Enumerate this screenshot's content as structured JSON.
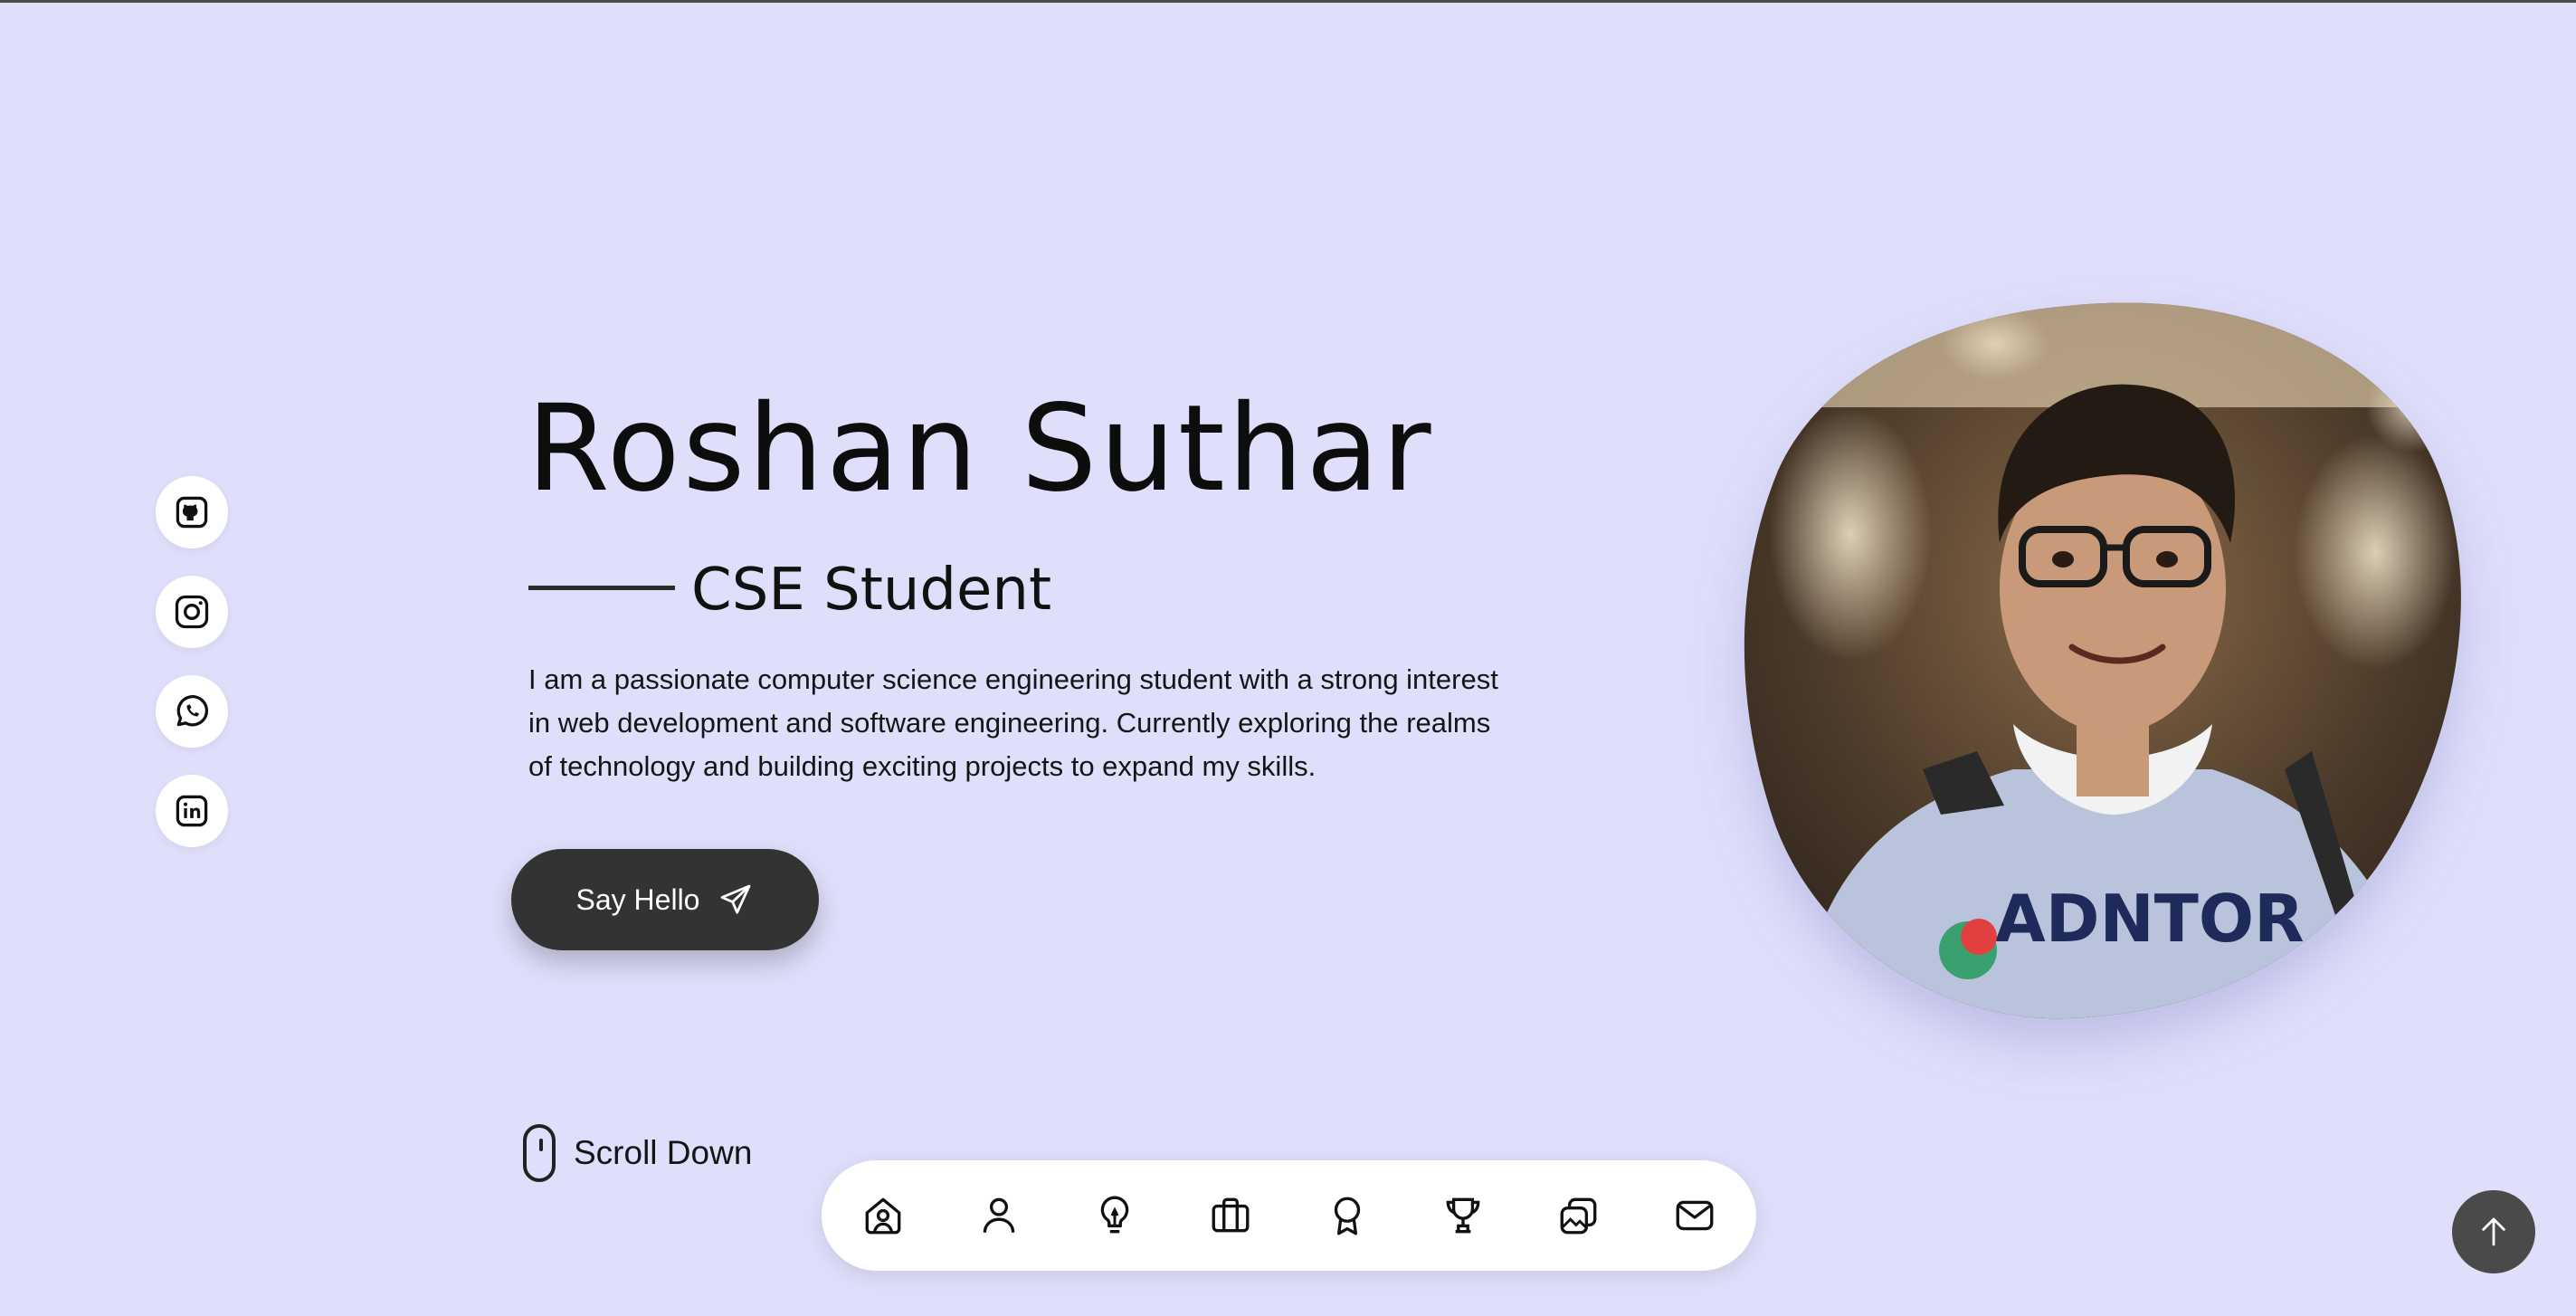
{
  "profile": {
    "name": "Roshan Suthar",
    "title": "CSE Student",
    "bio": "I am a passionate computer science engineering student with a strong interest in web development and software engineering. Currently exploring the realms of technology and building exciting projects to expand my skills.",
    "photo_shirt_text": "ADNTOR"
  },
  "buttons": {
    "say_hello": "Say Hello",
    "scroll_down": "Scroll Down"
  },
  "social": [
    {
      "icon": "github-icon"
    },
    {
      "icon": "instagram-icon"
    },
    {
      "icon": "whatsapp-icon"
    },
    {
      "icon": "linkedin-icon"
    }
  ],
  "nav": [
    {
      "icon": "home-icon"
    },
    {
      "icon": "user-icon"
    },
    {
      "icon": "lightbulb-icon"
    },
    {
      "icon": "briefcase-icon"
    },
    {
      "icon": "award-icon"
    },
    {
      "icon": "trophy-icon"
    },
    {
      "icon": "gallery-icon"
    },
    {
      "icon": "mail-icon"
    }
  ],
  "colors": {
    "background": "#dfdffb",
    "button_dark": "#333333",
    "scroll_top_button": "#4a4a4a"
  }
}
